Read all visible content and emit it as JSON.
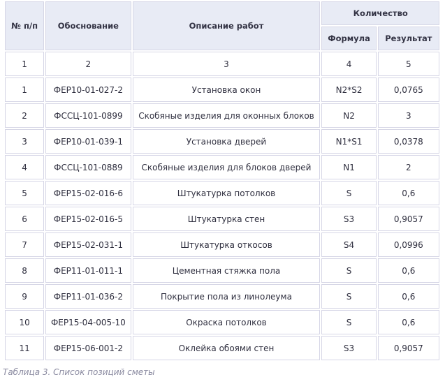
{
  "table": {
    "headers": {
      "num": "№ п/п",
      "basis": "Обоснование",
      "description": "Описание работ",
      "quantity": "Количество",
      "formula": "Формула",
      "result": "Результат"
    },
    "column_numbers": [
      "1",
      "2",
      "3",
      "4",
      "5"
    ],
    "rows": [
      {
        "num": "1",
        "basis": "ФЕР10-01-027-2",
        "description": "Установка окон",
        "formula": "N2*S2",
        "result": "0,0765"
      },
      {
        "num": "2",
        "basis": "ФССЦ-101-0899",
        "description": "Скобяные изделия для оконных блоков",
        "formula": "N2",
        "result": "3"
      },
      {
        "num": "3",
        "basis": "ФЕР10-01-039-1",
        "description": "Установка дверей",
        "formula": "N1*S1",
        "result": "0,0378"
      },
      {
        "num": "4",
        "basis": "ФССЦ-101-0889",
        "description": "Скобяные изделия для блоков дверей",
        "formula": "N1",
        "result": "2"
      },
      {
        "num": "5",
        "basis": "ФЕР15-02-016-6",
        "description": "Штукатурка потолков",
        "formula": "S",
        "result": "0,6"
      },
      {
        "num": "6",
        "basis": "ФЕР15-02-016-5",
        "description": "Штукатурка стен",
        "formula": "S3",
        "result": "0,9057"
      },
      {
        "num": "7",
        "basis": "ФЕР15-02-031-1",
        "description": "Штукатурка откосов",
        "formula": "S4",
        "result": "0,0996"
      },
      {
        "num": "8",
        "basis": "ФЕР11-01-011-1",
        "description": "Цементная стяжка пола",
        "formula": "S",
        "result": "0,6"
      },
      {
        "num": "9",
        "basis": "ФЕР11-01-036-2",
        "description": "Покрытие пола из линолеума",
        "formula": "S",
        "result": "0,6"
      },
      {
        "num": "10",
        "basis": "ФЕР15-04-005-10",
        "description": "Окраска потолков",
        "formula": "S",
        "result": "0,6"
      },
      {
        "num": "11",
        "basis": "ФЕР15-06-001-2",
        "description": "Оклейка обоями стен",
        "formula": "S3",
        "result": "0,9057"
      }
    ]
  },
  "caption": "Таблица 3. Список позиций сметы"
}
